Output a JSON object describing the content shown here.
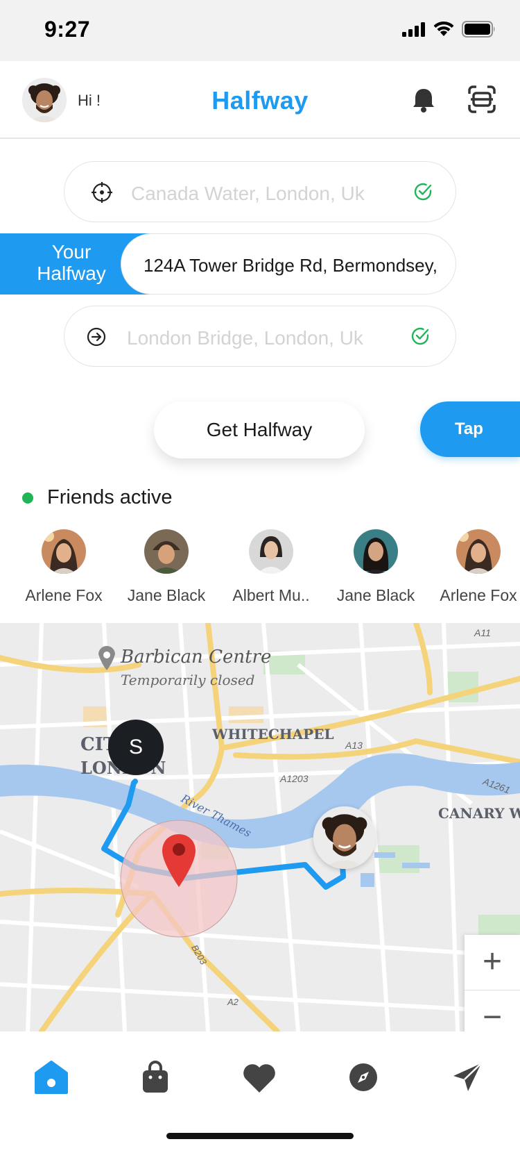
{
  "status_bar": {
    "time": "9:27"
  },
  "header": {
    "greeting": "Hi !",
    "title": "Halfway"
  },
  "route": {
    "from": {
      "value": "Canada Water, London, Uk"
    },
    "halfway": {
      "tag_line1": "Your",
      "tag_line2": "Halfway",
      "value": "124A Tower Bridge Rd, Bermondsey,"
    },
    "to": {
      "value": "London Bridge, London, Uk"
    }
  },
  "actions": {
    "get_halfway": "Get Halfway",
    "tap": "Tap"
  },
  "friends": {
    "title": "Friends active",
    "list": [
      {
        "name": "Arlene Fox"
      },
      {
        "name": "Jane Black"
      },
      {
        "name": "Albert Mu.."
      },
      {
        "name": "Jane Black"
      },
      {
        "name": "Arlene Fox"
      }
    ]
  },
  "map": {
    "poi_name": "Barbican Centre",
    "poi_status": "Temporarily closed",
    "area_city": "CITY",
    "area_city2": "LONDON",
    "area_whitechapel": "WHITECHAPEL",
    "area_canary": "CANARY WHA",
    "river": "River Thames",
    "road_a13": "A13",
    "road_a1203": "A1203",
    "road_a1261": "A1261",
    "road_a11": "A11",
    "road_b203": "B203",
    "road_a2": "A2",
    "start_marker": "S",
    "zoom_in": "+",
    "zoom_out": "−",
    "colors": {
      "route": "#1e9bf0",
      "pin": "#e53935",
      "radius_fill": "#f4c7c7"
    }
  },
  "nav": {
    "icons": [
      "home-icon",
      "bag-icon",
      "heart-icon",
      "compass-icon",
      "send-icon"
    ]
  },
  "theme": {
    "accent": "#1e9bf0",
    "active_green": "#20b457"
  }
}
